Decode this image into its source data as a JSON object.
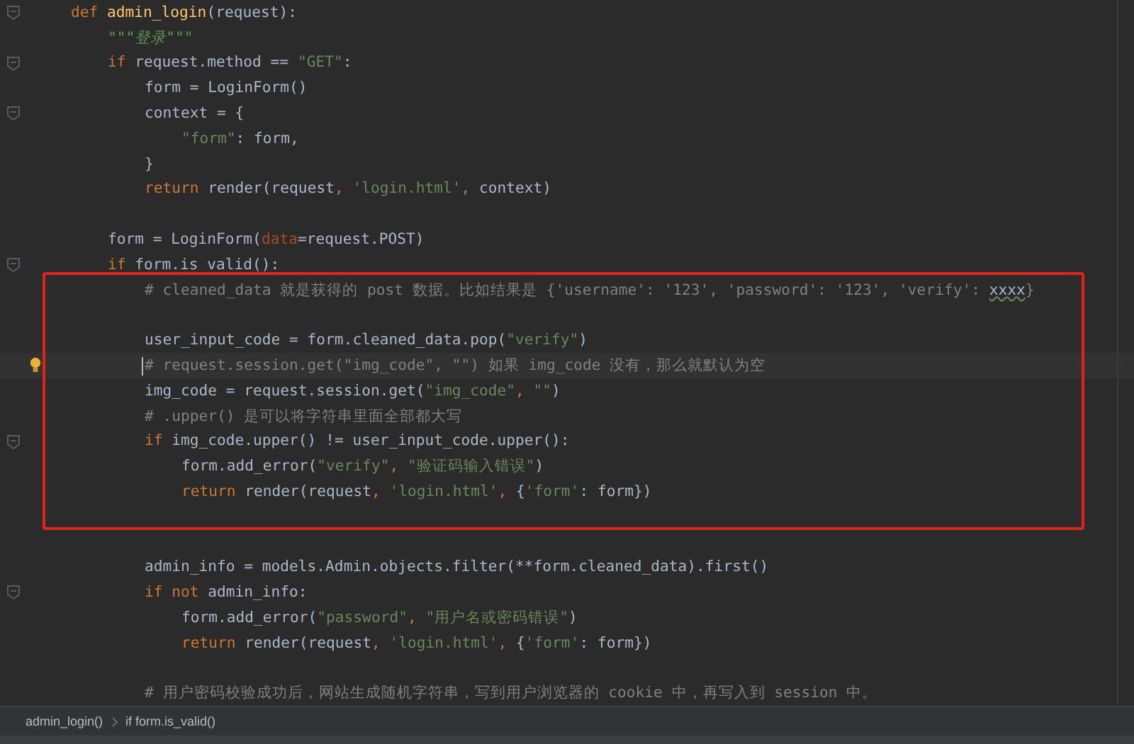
{
  "editor": {
    "lines": [
      {
        "kind": "line",
        "current": false,
        "tokens": [
          {
            "kind": "keyword",
            "text": "def "
          },
          {
            "kind": "function",
            "text": "admin_login"
          },
          {
            "kind": "plain",
            "text": "(request):"
          }
        ],
        "children": [
          {
            "kind": "line",
            "current": false,
            "tokens": [
              {
                "kind": "docstring",
                "text": "\"\"\"登录\"\"\""
              }
            ]
          },
          {
            "kind": "line",
            "current": false,
            "tokens": [
              {
                "kind": "keyword",
                "text": "if "
              },
              {
                "kind": "plain",
                "text": "request.method == "
              },
              {
                "kind": "string",
                "text": "\"GET\""
              },
              {
                "kind": "plain",
                "text": ":"
              }
            ],
            "children": [
              {
                "kind": "line",
                "current": false,
                "tokens": [
                  {
                    "kind": "plain",
                    "text": "form = LoginForm()"
                  }
                ]
              },
              {
                "kind": "line",
                "current": false,
                "tokens": [
                  {
                    "kind": "plain",
                    "text": "context = {"
                  }
                ],
                "children": [
                  {
                    "kind": "line",
                    "current": false,
                    "tokens": [
                      {
                        "kind": "string",
                        "text": "\"form\""
                      },
                      {
                        "kind": "plain",
                        "text": ": form,"
                      }
                    ]
                  }
                ]
              },
              {
                "kind": "line",
                "current": false,
                "tokens": [
                  {
                    "kind": "plain",
                    "text": "}"
                  }
                ]
              },
              {
                "kind": "line",
                "current": false,
                "tokens": [
                  {
                    "kind": "keyword",
                    "text": "return "
                  },
                  {
                    "kind": "plain",
                    "text": "render(request"
                  },
                  {
                    "kind": "keyword",
                    "text": ", "
                  },
                  {
                    "kind": "string",
                    "text": "'login.html'"
                  },
                  {
                    "kind": "keyword",
                    "text": ", "
                  },
                  {
                    "kind": "plain",
                    "text": "context)"
                  }
                ]
              }
            ]
          },
          {
            "kind": "blank"
          },
          {
            "kind": "line",
            "current": false,
            "tokens": [
              {
                "kind": "plain",
                "text": "form = LoginForm("
              },
              {
                "kind": "parameter",
                "text": "data"
              },
              {
                "kind": "plain",
                "text": "=request.POST)"
              }
            ]
          },
          {
            "kind": "line",
            "current": false,
            "tokens": [
              {
                "kind": "keyword",
                "text": "if "
              },
              {
                "kind": "plain",
                "text": "form.is_valid():"
              }
            ],
            "children": [
              {
                "kind": "box",
                "children": [
                  {
                    "kind": "line",
                    "current": false,
                    "tokens": [
                      {
                        "kind": "comment",
                        "text": "# cleaned_data 就是获得的 post 数据。比如结果是 {'username': '123', 'password': '123', 'verify': "
                      },
                      {
                        "kind": "warning",
                        "text": "xxxx"
                      },
                      {
                        "kind": "comment",
                        "text": "}"
                      }
                    ]
                  },
                  {
                    "kind": "blank"
                  },
                  {
                    "kind": "line",
                    "current": false,
                    "tokens": [
                      {
                        "kind": "plain",
                        "text": "user_input_code = form.cleaned_data.pop("
                      },
                      {
                        "kind": "string",
                        "text": "\"verify\""
                      },
                      {
                        "kind": "plain",
                        "text": ")"
                      }
                    ]
                  },
                  {
                    "kind": "line",
                    "current": true,
                    "tokens": [
                      {
                        "kind": "comment",
                        "text": "# request.session.get(\"img_code\", \"\") 如果 img_code 没有，那么就默认为空"
                      }
                    ]
                  },
                  {
                    "kind": "line",
                    "current": false,
                    "tokens": [
                      {
                        "kind": "plain",
                        "text": "img_code = request.session.get("
                      },
                      {
                        "kind": "string",
                        "text": "\"img_code\""
                      },
                      {
                        "kind": "keyword",
                        "text": ", "
                      },
                      {
                        "kind": "string",
                        "text": "\"\""
                      },
                      {
                        "kind": "plain",
                        "text": ")"
                      }
                    ]
                  },
                  {
                    "kind": "line",
                    "current": false,
                    "tokens": [
                      {
                        "kind": "comment",
                        "text": "# .upper() 是可以将字符串里面全部都大写"
                      }
                    ]
                  },
                  {
                    "kind": "line",
                    "current": false,
                    "tokens": [
                      {
                        "kind": "keyword",
                        "text": "if "
                      },
                      {
                        "kind": "plain",
                        "text": "img_code.upper() != user_input_code.upper():"
                      }
                    ],
                    "children": [
                      {
                        "kind": "line",
                        "current": false,
                        "tokens": [
                          {
                            "kind": "plain",
                            "text": "form.add_error("
                          },
                          {
                            "kind": "string",
                            "text": "\"verify\""
                          },
                          {
                            "kind": "keyword",
                            "text": ", "
                          },
                          {
                            "kind": "string",
                            "text": "\"验证码输入错误\""
                          },
                          {
                            "kind": "plain",
                            "text": ")"
                          }
                        ]
                      },
                      {
                        "kind": "line",
                        "current": false,
                        "tokens": [
                          {
                            "kind": "keyword",
                            "text": "return "
                          },
                          {
                            "kind": "plain",
                            "text": "render(request"
                          },
                          {
                            "kind": "keyword",
                            "text": ", "
                          },
                          {
                            "kind": "string",
                            "text": "'login.html'"
                          },
                          {
                            "kind": "keyword",
                            "text": ", "
                          },
                          {
                            "kind": "plain",
                            "text": "{"
                          },
                          {
                            "kind": "string",
                            "text": "'form'"
                          },
                          {
                            "kind": "plain",
                            "text": ": form})"
                          }
                        ]
                      }
                    ]
                  },
                  {
                    "kind": "blank"
                  }
                ]
              },
              {
                "kind": "blank"
              },
              {
                "kind": "line",
                "current": false,
                "tokens": [
                  {
                    "kind": "plain",
                    "text": "admin_info = models.Admin.objects.filter(**form.cleaned_data).first()"
                  }
                ]
              },
              {
                "kind": "line",
                "current": false,
                "tokens": [
                  {
                    "kind": "keyword",
                    "text": "if not "
                  },
                  {
                    "kind": "plain",
                    "text": "admin_info:"
                  }
                ],
                "children": [
                  {
                    "kind": "line",
                    "current": false,
                    "tokens": [
                      {
                        "kind": "plain",
                        "text": "form.add_error("
                      },
                      {
                        "kind": "string",
                        "text": "\"password\""
                      },
                      {
                        "kind": "keyword",
                        "text": ", "
                      },
                      {
                        "kind": "string",
                        "text": "\"用户名或密码错误\""
                      },
                      {
                        "kind": "plain",
                        "text": ")"
                      }
                    ]
                  },
                  {
                    "kind": "line",
                    "current": false,
                    "tokens": [
                      {
                        "kind": "keyword",
                        "text": "return "
                      },
                      {
                        "kind": "plain",
                        "text": "render(request"
                      },
                      {
                        "kind": "keyword",
                        "text": ", "
                      },
                      {
                        "kind": "string",
                        "text": "'login.html'"
                      },
                      {
                        "kind": "keyword",
                        "text": ", "
                      },
                      {
                        "kind": "plain",
                        "text": "{"
                      },
                      {
                        "kind": "string",
                        "text": "'form'"
                      },
                      {
                        "kind": "plain",
                        "text": ": form})"
                      }
                    ]
                  }
                ]
              },
              {
                "kind": "blank"
              },
              {
                "kind": "line",
                "current": false,
                "tokens": [
                  {
                    "kind": "comment",
                    "text": "# 用户密码校验成功后，网站生成随机字符串，写到用户浏览器的 cookie 中，再写入到 session 中。"
                  }
                ]
              }
            ]
          }
        ]
      }
    ]
  },
  "breadcrumbs": [
    "admin_login()",
    "if form.is_valid()"
  ]
}
